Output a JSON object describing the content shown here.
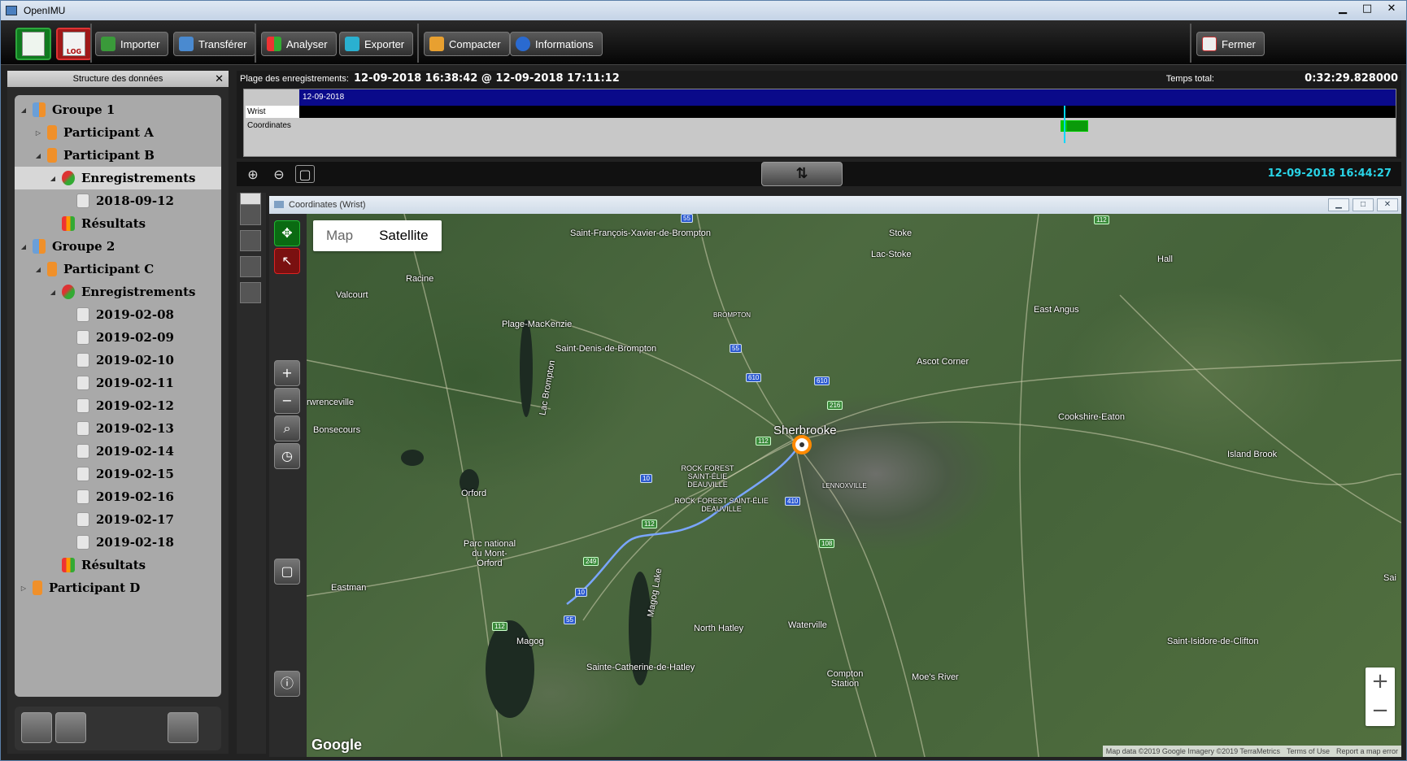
{
  "window": {
    "title": "OpenIMU",
    "btn_min": "▁",
    "btn_max": "□",
    "btn_close": "✕"
  },
  "toolbar": {
    "big_log_label": "LOG",
    "import": "Importer",
    "transfer": "Transférer",
    "analyse": "Analyser",
    "export": "Exporter",
    "compact": "Compacter",
    "info": "Informations",
    "close": "Fermer"
  },
  "sidebar": {
    "header": "Structure des données",
    "close_icon": "✕",
    "tree": [
      {
        "label": "Groupe 1",
        "level": 0,
        "icon": "group",
        "arrow": "◢"
      },
      {
        "label": "Participant A",
        "level": 1,
        "icon": "person",
        "arrow": "▷"
      },
      {
        "label": "Participant B",
        "level": 1,
        "icon": "person",
        "arrow": "◢"
      },
      {
        "label": "Enregistrements",
        "level": 2,
        "icon": "recordings",
        "arrow": "◢",
        "selected": true
      },
      {
        "label": "2018-09-12",
        "level": 3,
        "icon": "date",
        "arrow": ""
      },
      {
        "label": "Résultats",
        "level": 2,
        "icon": "results",
        "arrow": ""
      },
      {
        "label": "Groupe 2",
        "level": 0,
        "icon": "group",
        "arrow": "◢"
      },
      {
        "label": "Participant C",
        "level": 1,
        "icon": "person",
        "arrow": "◢"
      },
      {
        "label": "Enregistrements",
        "level": 2,
        "icon": "recordings",
        "arrow": "◢"
      },
      {
        "label": "2019-02-08",
        "level": 3,
        "icon": "date",
        "arrow": ""
      },
      {
        "label": "2019-02-09",
        "level": 3,
        "icon": "date",
        "arrow": ""
      },
      {
        "label": "2019-02-10",
        "level": 3,
        "icon": "date",
        "arrow": ""
      },
      {
        "label": "2019-02-11",
        "level": 3,
        "icon": "date",
        "arrow": ""
      },
      {
        "label": "2019-02-12",
        "level": 3,
        "icon": "date",
        "arrow": ""
      },
      {
        "label": "2019-02-13",
        "level": 3,
        "icon": "date",
        "arrow": ""
      },
      {
        "label": "2019-02-14",
        "level": 3,
        "icon": "date",
        "arrow": ""
      },
      {
        "label": "2019-02-15",
        "level": 3,
        "icon": "date",
        "arrow": ""
      },
      {
        "label": "2019-02-16",
        "level": 3,
        "icon": "date",
        "arrow": ""
      },
      {
        "label": "2019-02-17",
        "level": 3,
        "icon": "date",
        "arrow": ""
      },
      {
        "label": "2019-02-18",
        "level": 3,
        "icon": "date",
        "arrow": ""
      },
      {
        "label": "Résultats",
        "level": 2,
        "icon": "results",
        "arrow": ""
      },
      {
        "label": "Participant D",
        "level": 0,
        "icon": "person",
        "arrow": "▷"
      }
    ]
  },
  "timeline": {
    "range_label": "Plage des enregistrements:",
    "range_value": "12-09-2018 16:38:42 @ 12-09-2018 17:11:12",
    "total_label": "Temps total:",
    "total_value": "0:32:29.828000",
    "date_row": "12-09-2018",
    "row_wrist": "Wrist",
    "row_coordinates": "Coordinates"
  },
  "controls": {
    "current_time": "12-09-2018 16:44:27",
    "center_icon": "⇅"
  },
  "mapwindow": {
    "title": "Coordinates (Wrist)",
    "maptype_map": "Map",
    "maptype_satellite": "Satellite",
    "zoom_in": "+",
    "zoom_out": "−",
    "google": "Google",
    "attrib_data": "Map data ©2019 Google Imagery ©2019 TerraMetrics",
    "attrib_terms": "Terms of Use",
    "attrib_report": "Report a map error",
    "places": [
      "Saint-François-Xavier-de-Brompton",
      "Stoke",
      "Lac-Stoke",
      "Hall",
      "Racine",
      "Valcourt",
      "BROMPTON",
      "Plage-MacKenzie",
      "East Angus",
      "Saint-Denis-de-Brompton",
      "Ascot Corner",
      "Lac Brompton",
      "rwrenceville",
      "Bonsecours",
      "Sherbrooke",
      "Cookshire-Eaton",
      "Island Brook",
      "ROCK FOREST SAINT-ÉLIE DEAUVILLE",
      "ROCK FOREST SAINT-ÉLIE DEAUVILLE",
      "Orford",
      "LENNOXVILLE",
      "Parc national du Mont-Orford",
      "Magog Lake",
      "Eastman",
      "Waterville",
      "North Hatley",
      "Magog",
      "Saint-Isidore-de-Clifton",
      "Sainte-Catherine-de-Hatley",
      "Compton Station",
      "Moe's River",
      "Sai"
    ]
  },
  "colors": {
    "timeline_date_bar": "#0a0a8a",
    "timeline_segment": "#0a9a0a",
    "cursor": "#00d8ff",
    "current_time": "#29d3e6"
  }
}
